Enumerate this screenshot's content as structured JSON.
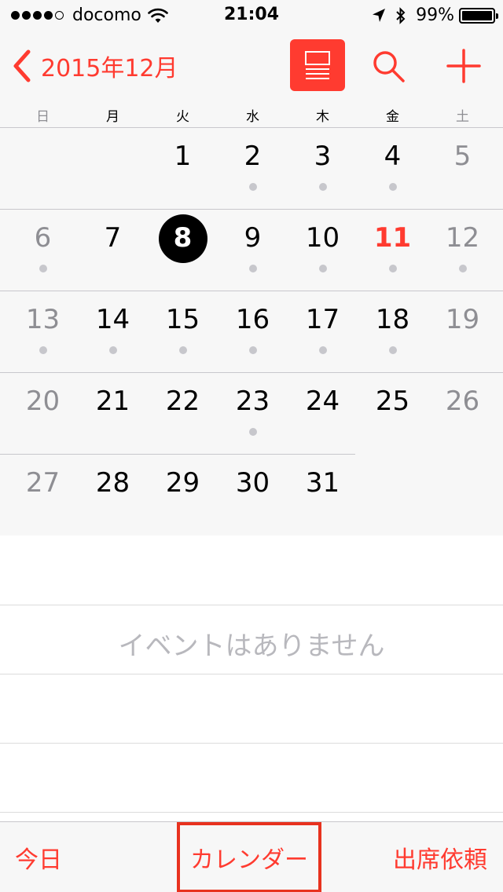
{
  "status_bar": {
    "carrier": "docomo",
    "time": "21:04",
    "battery_percent": "99%",
    "battery_level": 0.99,
    "signal_bars_filled": 4,
    "signal_bars_total": 5
  },
  "nav_bar": {
    "back_label": "2015年12月",
    "icons": [
      "chevron-left-icon",
      "list-view-icon",
      "search-icon",
      "plus-icon"
    ]
  },
  "weekdays": [
    "日",
    "月",
    "火",
    "水",
    "木",
    "金",
    "土"
  ],
  "calendar": {
    "weeks": [
      [
        {
          "day": ""
        },
        {
          "day": ""
        },
        {
          "day": "1",
          "dot": false
        },
        {
          "day": "2",
          "dot": true
        },
        {
          "day": "3",
          "dot": true
        },
        {
          "day": "4",
          "dot": true
        },
        {
          "day": "5",
          "dot": false,
          "weekend": true
        }
      ],
      [
        {
          "day": "6",
          "dot": true,
          "weekend": true
        },
        {
          "day": "7",
          "dot": false
        },
        {
          "day": "8",
          "dot": false,
          "selected": true
        },
        {
          "day": "9",
          "dot": true
        },
        {
          "day": "10",
          "dot": true
        },
        {
          "day": "11",
          "dot": true,
          "holiday": true
        },
        {
          "day": "12",
          "dot": true,
          "weekend": true
        }
      ],
      [
        {
          "day": "13",
          "dot": true,
          "weekend": true
        },
        {
          "day": "14",
          "dot": true
        },
        {
          "day": "15",
          "dot": true
        },
        {
          "day": "16",
          "dot": true
        },
        {
          "day": "17",
          "dot": true
        },
        {
          "day": "18",
          "dot": true
        },
        {
          "day": "19",
          "dot": false,
          "weekend": true
        }
      ],
      [
        {
          "day": "20",
          "dot": false,
          "weekend": true
        },
        {
          "day": "21",
          "dot": false
        },
        {
          "day": "22",
          "dot": false
        },
        {
          "day": "23",
          "dot": true
        },
        {
          "day": "24",
          "dot": false
        },
        {
          "day": "25",
          "dot": false
        },
        {
          "day": "26",
          "dot": false,
          "weekend": true
        }
      ],
      [
        {
          "day": "27",
          "dot": false,
          "weekend": true
        },
        {
          "day": "28",
          "dot": false
        },
        {
          "day": "29",
          "dot": false
        },
        {
          "day": "30",
          "dot": false
        },
        {
          "day": "31",
          "dot": false
        },
        {
          "day": ""
        },
        {
          "day": ""
        }
      ]
    ]
  },
  "events": {
    "empty_message": "イベントはありません"
  },
  "tab_bar": {
    "today_label": "今日",
    "calendars_label": "カレンダー",
    "inbox_label": "出席依頼"
  },
  "colors": {
    "accent": "#ff3b30",
    "highlight_box": "#e8321f"
  }
}
